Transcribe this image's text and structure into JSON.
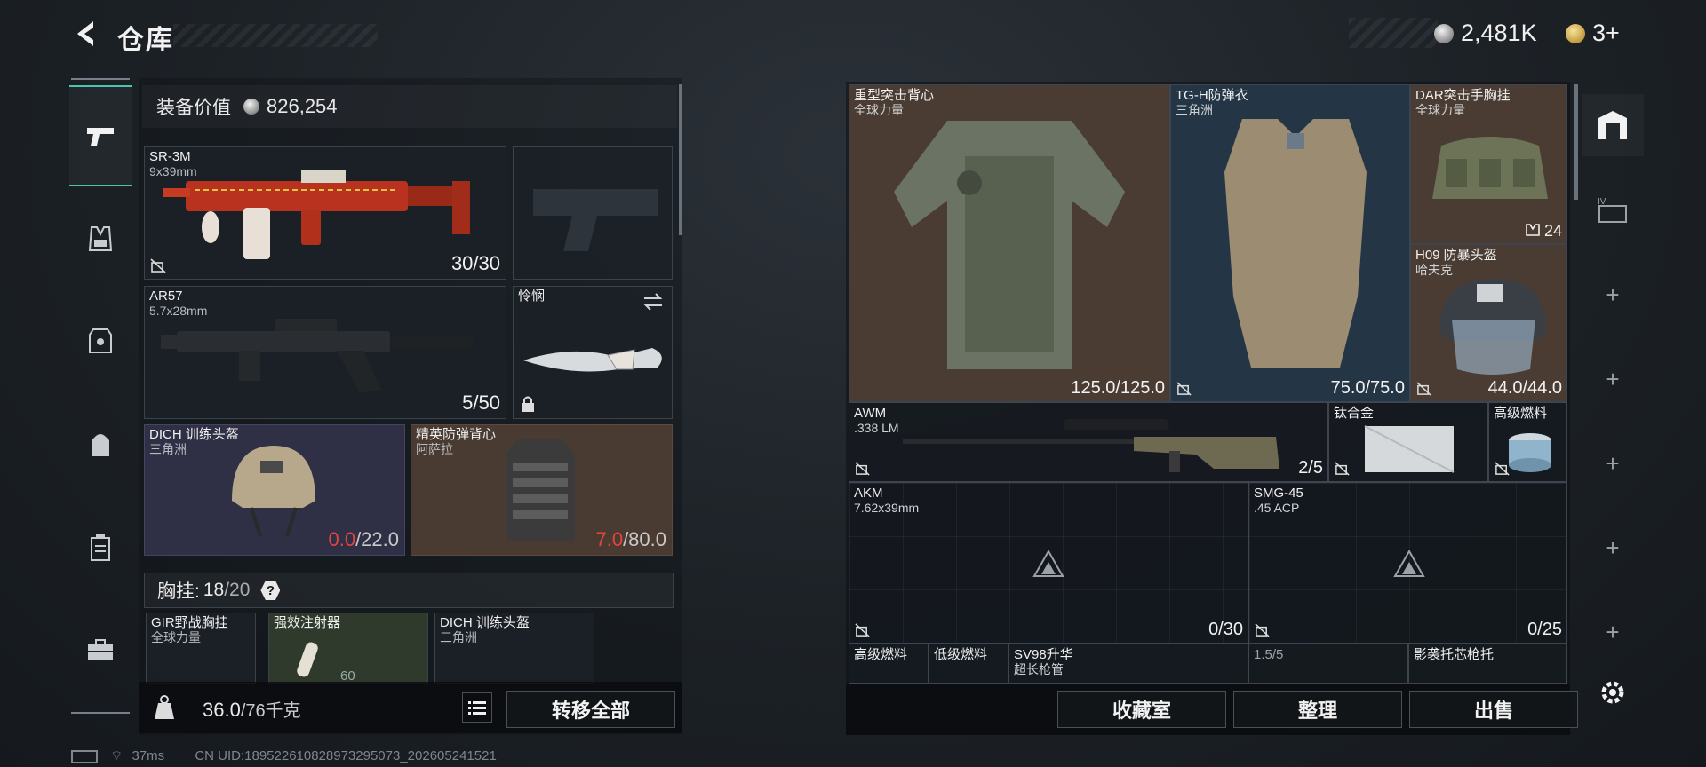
{
  "header": {
    "title": "仓库",
    "currency": [
      {
        "icon": "silver-coin-icon",
        "value": "2,481K"
      },
      {
        "icon": "gold-coin-icon",
        "value": "3+"
      }
    ]
  },
  "left_rail": [
    "weapon-tab-icon",
    "chest-rig-tab-icon",
    "armor-tab-icon",
    "backpack-tab-icon",
    "container-tab-icon",
    "medkit-tab-icon"
  ],
  "loadout": {
    "equip_value_label": "装备价值",
    "equip_value": "826,254",
    "primary": {
      "name": "SR-3M",
      "ammo": "9x39mm",
      "count": "30/30"
    },
    "secondary": {
      "name": "AR57",
      "ammo": "5.7x28mm",
      "count": "5/50"
    },
    "melee": {
      "name": "怜悯"
    },
    "helmet": {
      "name": "DICH 训练头盔",
      "maker": "三角洲",
      "durability": "0.0",
      "max": "/22.0"
    },
    "armor": {
      "name": "精英防弹背心",
      "maker": "阿萨拉",
      "durability": "7.0",
      "max": "/80.0"
    },
    "chest_rig_label": "胸挂:",
    "chest_rig_used": "18",
    "chest_rig_total": "/20",
    "help": "?",
    "rig_items": [
      {
        "name": "GIR野战胸挂",
        "maker": "全球力量"
      },
      {
        "name": "强效注射器",
        "extra": "60"
      },
      {
        "name": "DICH 训练头盔",
        "maker": "三角洲"
      }
    ],
    "weight": "36.0",
    "weight_max": "/76千克",
    "transfer_all": "转移全部"
  },
  "stash": {
    "items": [
      {
        "name": "重型突击背心",
        "maker": "全球力量",
        "count": "125.0/125.0"
      },
      {
        "name": "TG-H防弹衣",
        "maker": "三角洲",
        "count": "75.0/75.0"
      },
      {
        "name": "DAR突击手胸挂",
        "maker": "全球力量",
        "count": "24"
      },
      {
        "name": "H09 防暴头盔",
        "maker": "哈夫克",
        "count": "44.0/44.0"
      },
      {
        "name": "AWM",
        "maker": ".338 LM",
        "count": "2/5"
      },
      {
        "name": "钛合金"
      },
      {
        "name": "高级燃料"
      },
      {
        "name": "AKM",
        "maker": "7.62x39mm",
        "count": "0/30"
      },
      {
        "name": "SMG-45",
        "maker": ".45 ACP",
        "count": "0/25"
      },
      {
        "name": "高级燃料"
      },
      {
        "name": "低级燃料"
      },
      {
        "name": "SV98升华",
        "maker": "超长枪管"
      },
      {
        "name": "1.5/5"
      },
      {
        "name": "影袭托芯枪托"
      }
    ],
    "buttons": {
      "collection": "收藏室",
      "sort": "整理",
      "sell": "出售"
    }
  },
  "status": {
    "ping": "37ms",
    "uid": "CN UID:18952261082897329507​3_202605241521"
  }
}
